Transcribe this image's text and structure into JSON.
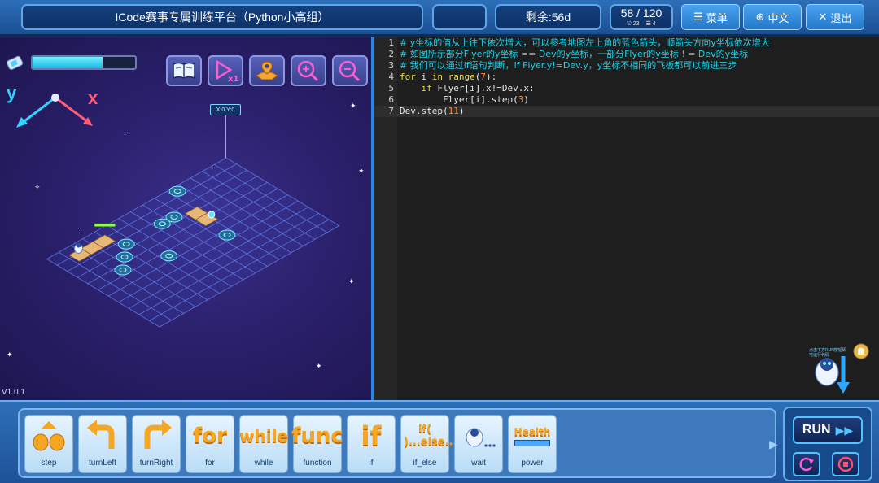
{
  "header": {
    "title": "ICode赛事专属训练平台（Python小高组）",
    "remaining": "剩余:56d",
    "score": "58 / 120",
    "stat_a": "23",
    "stat_b": "4",
    "menu_label": "菜单",
    "lang_label": "中文",
    "exit_label": "退出"
  },
  "game": {
    "energy_fill_fraction": 0.68,
    "axis_y": "y",
    "axis_x": "x",
    "coord_tag": "X:0 Y:0",
    "version": "V1.0.1",
    "tools": [
      "book-icon",
      "speed-x1-icon",
      "map-pin-icon",
      "zoom-in-icon",
      "zoom-out-icon"
    ]
  },
  "editor": {
    "lines": [
      {
        "n": "1",
        "text": "# y坐标的值从上往下依次增大，可以参考地图左上角的蓝色箭头，顺箭头方向y坐标依次增大"
      },
      {
        "n": "2",
        "text": "# 如图所示部分Flyer的y坐标 == Dev的y坐标，一部分Flyer的y坐标 ! = Dev的y坐标"
      },
      {
        "n": "3",
        "text": "# 我们可以通过if语句判断，if Flyer.y!=Dev.y，y坐标不相同的飞板都可以前进三步"
      },
      {
        "n": "4",
        "text": "for i in range(7):"
      },
      {
        "n": "5",
        "text": "    if Flyer[i].x!=Dev.x:"
      },
      {
        "n": "6",
        "text": "        Flyer[i].step(3)"
      },
      {
        "n": "7",
        "text": "Dev.step(11)"
      }
    ],
    "robot_tip": "点击下方RUN按钮即可运行代码"
  },
  "commands": [
    {
      "label": "step",
      "icon": "step-icon"
    },
    {
      "label": "turnLeft",
      "icon": "turn-left-icon"
    },
    {
      "label": "turnRight",
      "icon": "turn-right-icon"
    },
    {
      "label": "for",
      "icon": "for-icon",
      "word": "for"
    },
    {
      "label": "while",
      "icon": "while-icon",
      "word": "while"
    },
    {
      "label": "function",
      "icon": "func-icon",
      "word": "func"
    },
    {
      "label": "if",
      "icon": "if-icon",
      "word": "if"
    },
    {
      "label": "if_else",
      "icon": "if-else-icon",
      "word": "if( )...else..."
    },
    {
      "label": "wait",
      "icon": "wait-icon"
    },
    {
      "label": "power",
      "icon": "power-icon",
      "word": "Health"
    }
  ],
  "run": {
    "label": "RUN"
  },
  "colors": {
    "accent": "#2b86e0",
    "comment": "#1fd0e8",
    "keyword": "#e8e04a",
    "number": "#ff8a3d"
  }
}
